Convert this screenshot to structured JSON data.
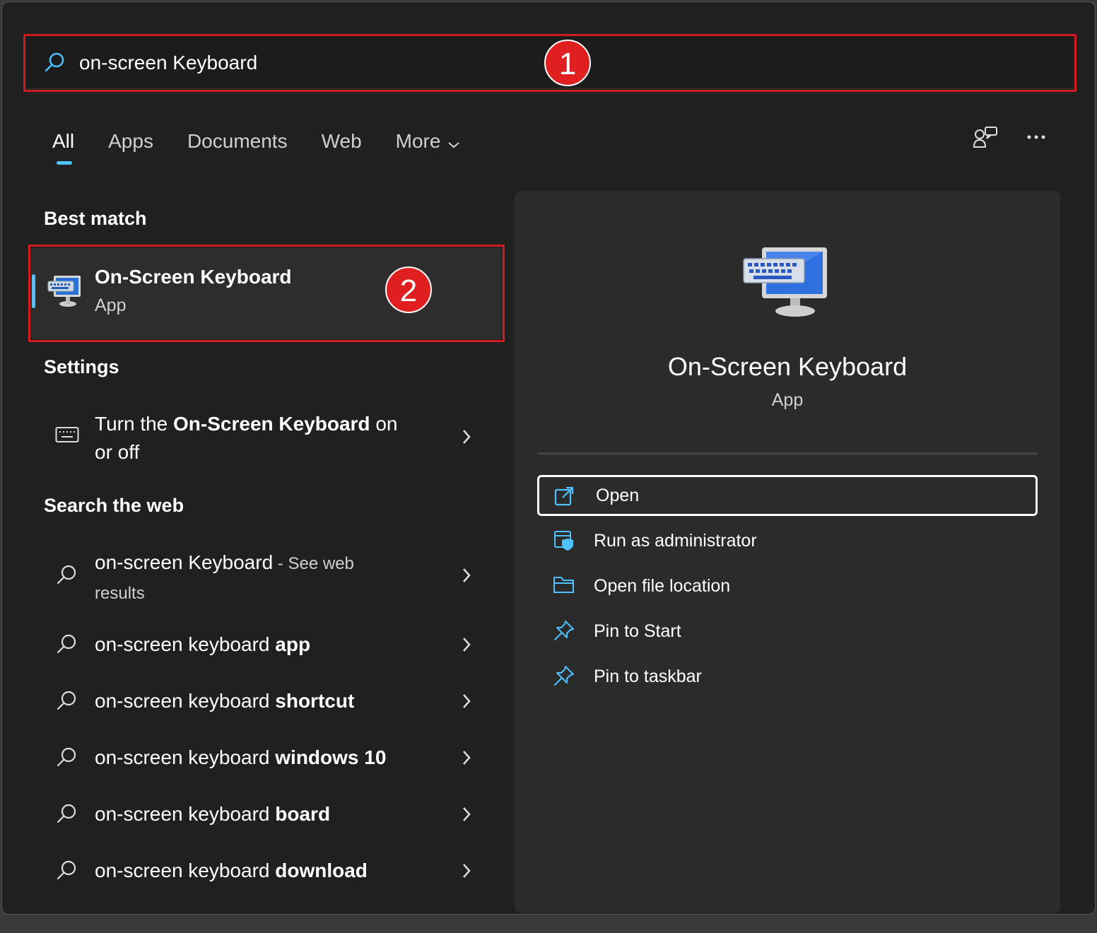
{
  "search": {
    "query": "on-screen Keyboard"
  },
  "badges": {
    "one": "1",
    "two": "2"
  },
  "tabs": [
    {
      "label": "All"
    },
    {
      "label": "Apps"
    },
    {
      "label": "Documents"
    },
    {
      "label": "Web"
    },
    {
      "label": "More"
    }
  ],
  "sections": {
    "best_match": "Best match",
    "settings": "Settings",
    "search_web": "Search the web"
  },
  "best_match": {
    "title": "On-Screen Keyboard",
    "subtitle": "App"
  },
  "settings_item": {
    "pre": "Turn the ",
    "bold": "On-Screen Keyboard",
    "post_line1": " on",
    "line2": "or off"
  },
  "web_results": [
    {
      "prefix": "on-screen Keyboard",
      "suffix": " - See web",
      "line2": "results"
    },
    {
      "prefix": "on-screen keyboard ",
      "bold": "app"
    },
    {
      "prefix": "on-screen keyboard ",
      "bold": "shortcut"
    },
    {
      "prefix": "on-screen keyboard ",
      "bold": "windows 10"
    },
    {
      "prefix": "on-screen keyboard ",
      "bold": "board"
    },
    {
      "prefix": "on-screen keyboard ",
      "bold": "download"
    }
  ],
  "preview": {
    "title": "On-Screen Keyboard",
    "subtitle": "App",
    "actions": [
      {
        "label": "Open",
        "icon": "open-icon"
      },
      {
        "label": "Run as administrator",
        "icon": "shield-window-icon"
      },
      {
        "label": "Open file location",
        "icon": "folder-icon"
      },
      {
        "label": "Pin to Start",
        "icon": "pin-icon"
      },
      {
        "label": "Pin to taskbar",
        "icon": "pin-icon"
      }
    ]
  },
  "colors": {
    "accent": "#4cc2ff",
    "annotation_red": "#d11a22",
    "background": "#202020"
  }
}
